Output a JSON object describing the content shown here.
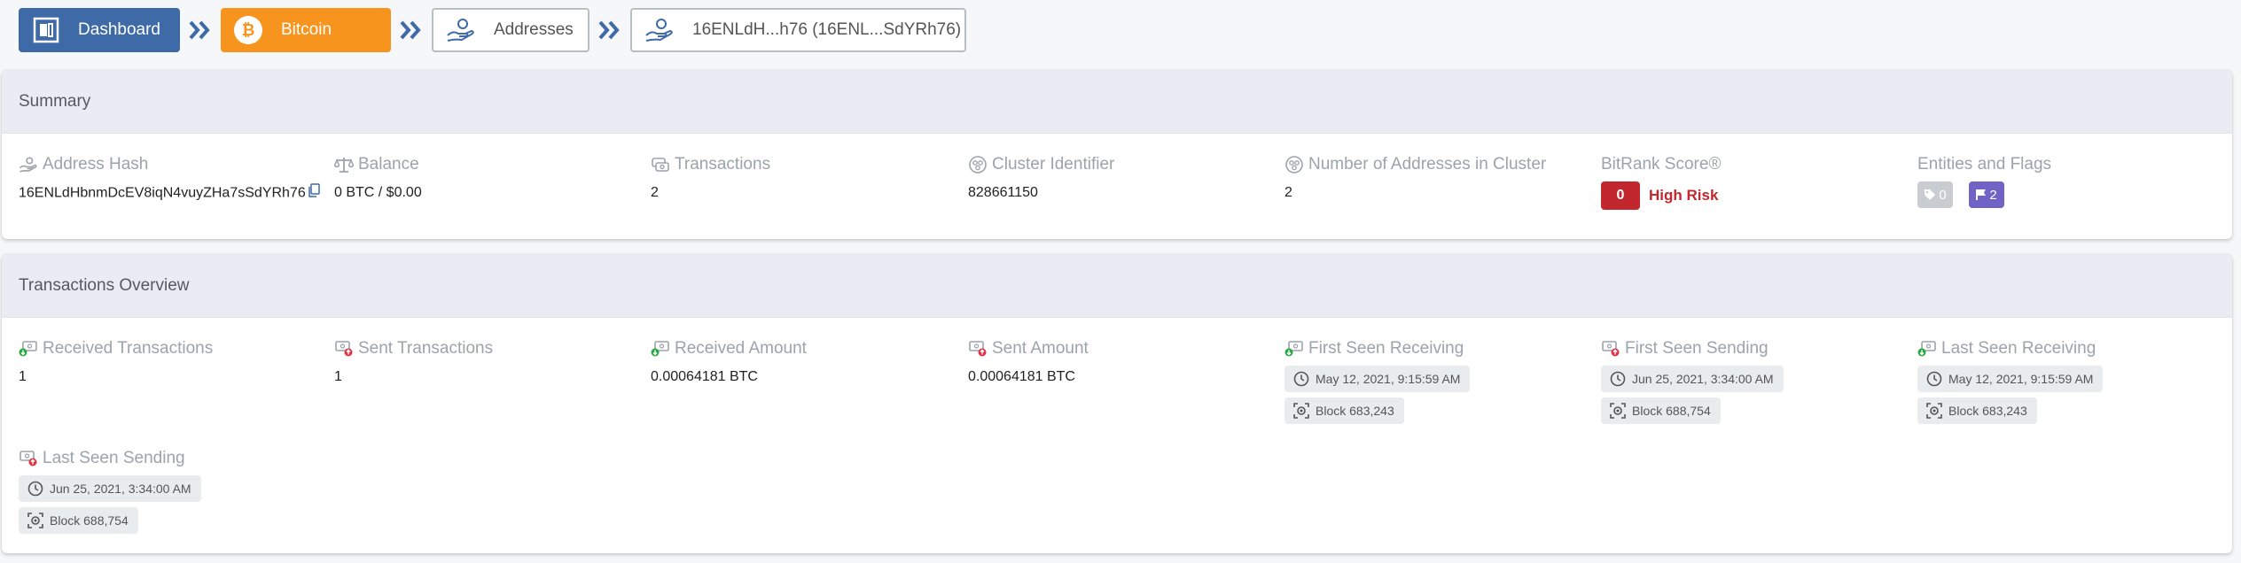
{
  "breadcrumb": {
    "items": [
      {
        "label": "Dashboard",
        "icon": "dashboard-icon",
        "color": "#3f6aa8"
      },
      {
        "label": "Bitcoin",
        "icon": "bitcoin-icon",
        "color": "#f7941d"
      },
      {
        "label": "Addresses",
        "icon": "address-hand-icon"
      },
      {
        "label": "16ENLdH...h76 (16ENL...SdYRh76)",
        "icon": "address-hand-icon"
      }
    ]
  },
  "summary": {
    "title": "Summary",
    "address_hash": {
      "label": "Address Hash",
      "value": "16ENLdHbnmDcEV8iqN4vuyZHa7sSdYRh76"
    },
    "balance": {
      "label": "Balance",
      "value": "0 BTC / $0.00"
    },
    "transactions": {
      "label": "Transactions",
      "value": "2"
    },
    "cluster_identifier": {
      "label": "Cluster Identifier",
      "value": "828661150"
    },
    "cluster_addresses": {
      "label": "Number of Addresses in Cluster",
      "value": "2"
    },
    "bitrank": {
      "label": "BitRank Score®",
      "score": "0",
      "level": "High Risk",
      "color": "#c1272d"
    },
    "entities_flags": {
      "label": "Entities and Flags",
      "tags_count": "0",
      "flags_count": "2"
    }
  },
  "overview": {
    "title": "Transactions Overview",
    "received_tx": {
      "label": "Received Transactions",
      "value": "1"
    },
    "sent_tx": {
      "label": "Sent Transactions",
      "value": "1"
    },
    "received_amount": {
      "label": "Received Amount",
      "value": "0.00064181 BTC"
    },
    "sent_amount": {
      "label": "Sent Amount",
      "value": "0.00064181 BTC"
    },
    "first_seen_receiving": {
      "label": "First Seen Receiving",
      "time": "May 12, 2021, 9:15:59 AM",
      "block": "Block 683,243"
    },
    "first_seen_sending": {
      "label": "First Seen Sending",
      "time": "Jun 25, 2021, 3:34:00 AM",
      "block": "Block 688,754"
    },
    "last_seen_receiving": {
      "label": "Last Seen Receiving",
      "time": "May 12, 2021, 9:15:59 AM",
      "block": "Block 683,243"
    },
    "last_seen_sending": {
      "label": "Last Seen Sending",
      "time": "Jun 25, 2021, 3:34:00 AM",
      "block": "Block 688,754"
    }
  }
}
